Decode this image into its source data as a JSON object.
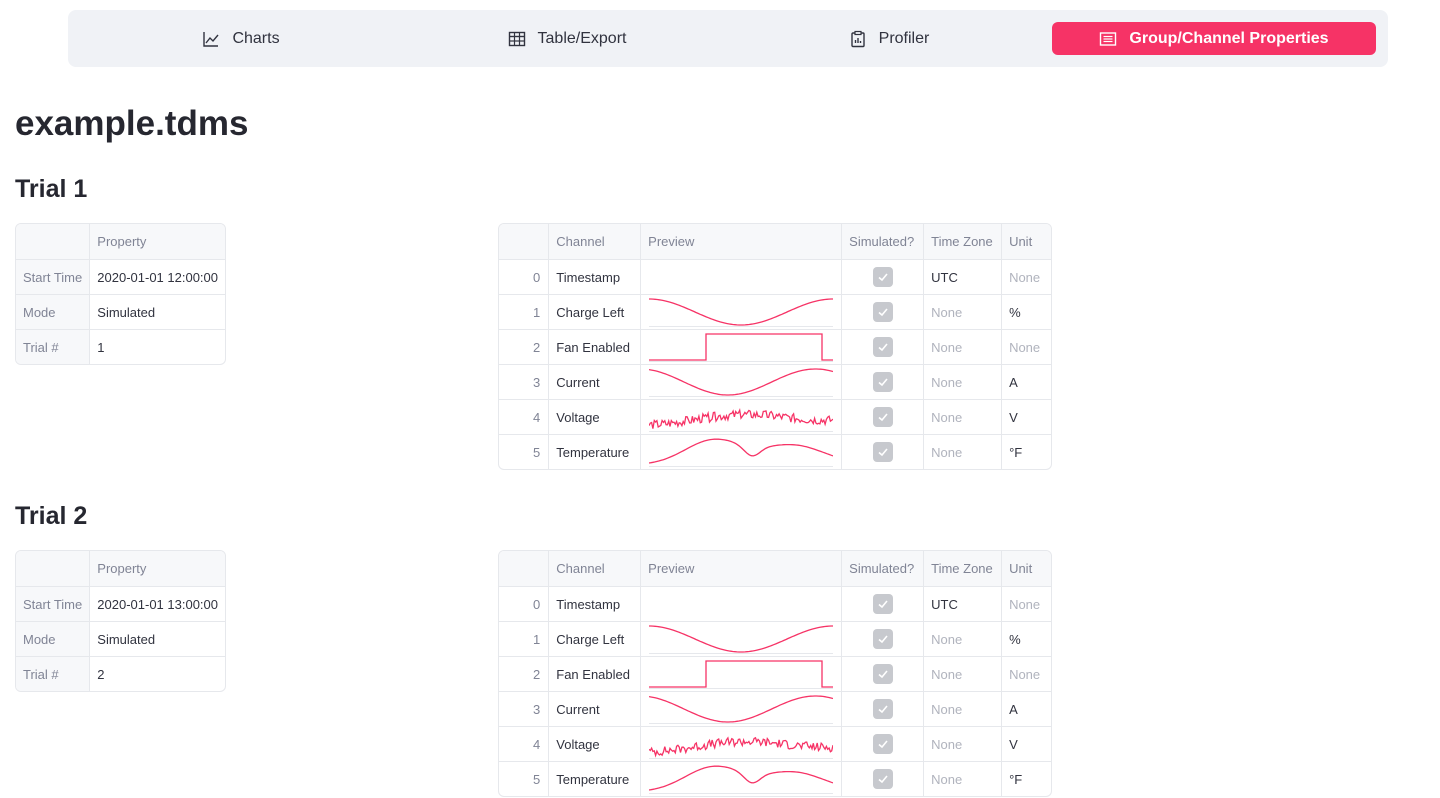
{
  "nav": {
    "items": [
      {
        "label": "Charts",
        "icon": "line-chart-icon"
      },
      {
        "label": "Table/Export",
        "icon": "table-icon"
      },
      {
        "label": "Profiler",
        "icon": "clipboard-icon"
      },
      {
        "label": "Group/Channel Properties",
        "icon": "list-icon"
      }
    ],
    "active_index": 3,
    "accent_color": "#f63366"
  },
  "page_title": "example.tdms",
  "groups": [
    {
      "title": "Trial 1",
      "properties": {
        "header": "Property",
        "rows": [
          {
            "key": "Start Time",
            "value": "2020-01-01 12:00:00"
          },
          {
            "key": "Mode",
            "value": "Simulated"
          },
          {
            "key": "Trial #",
            "value": "1"
          }
        ]
      },
      "channels": {
        "headers": [
          "Channel",
          "Preview",
          "Simulated?",
          "Time Zone",
          "Unit"
        ],
        "rows": [
          {
            "index": "0",
            "name": "Timestamp",
            "preview": "none",
            "simulated": true,
            "tz": "UTC",
            "unit": "None"
          },
          {
            "index": "1",
            "name": "Charge Left",
            "preview": "charge",
            "simulated": true,
            "tz": "None",
            "unit": "%"
          },
          {
            "index": "2",
            "name": "Fan Enabled",
            "preview": "fan",
            "simulated": true,
            "tz": "None",
            "unit": "None"
          },
          {
            "index": "3",
            "name": "Current",
            "preview": "current",
            "simulated": true,
            "tz": "None",
            "unit": "A"
          },
          {
            "index": "4",
            "name": "Voltage",
            "preview": "voltage",
            "simulated": true,
            "tz": "None",
            "unit": "V"
          },
          {
            "index": "5",
            "name": "Temperature",
            "preview": "temperature",
            "simulated": true,
            "tz": "None",
            "unit": "°F"
          }
        ]
      }
    },
    {
      "title": "Trial 2",
      "properties": {
        "header": "Property",
        "rows": [
          {
            "key": "Start Time",
            "value": "2020-01-01 13:00:00"
          },
          {
            "key": "Mode",
            "value": "Simulated"
          },
          {
            "key": "Trial #",
            "value": "2"
          }
        ]
      },
      "channels": {
        "headers": [
          "Channel",
          "Preview",
          "Simulated?",
          "Time Zone",
          "Unit"
        ],
        "rows": [
          {
            "index": "0",
            "name": "Timestamp",
            "preview": "none",
            "simulated": true,
            "tz": "UTC",
            "unit": "None"
          },
          {
            "index": "1",
            "name": "Charge Left",
            "preview": "charge",
            "simulated": true,
            "tz": "None",
            "unit": "%"
          },
          {
            "index": "2",
            "name": "Fan Enabled",
            "preview": "fan",
            "simulated": true,
            "tz": "None",
            "unit": "None"
          },
          {
            "index": "3",
            "name": "Current",
            "preview": "current",
            "simulated": true,
            "tz": "None",
            "unit": "A"
          },
          {
            "index": "4",
            "name": "Voltage",
            "preview": "voltage",
            "simulated": true,
            "tz": "None",
            "unit": "V"
          },
          {
            "index": "5",
            "name": "Temperature",
            "preview": "temperature",
            "simulated": true,
            "tz": "None",
            "unit": "°F"
          }
        ]
      }
    }
  ],
  "sparkline_color": "#f63366"
}
